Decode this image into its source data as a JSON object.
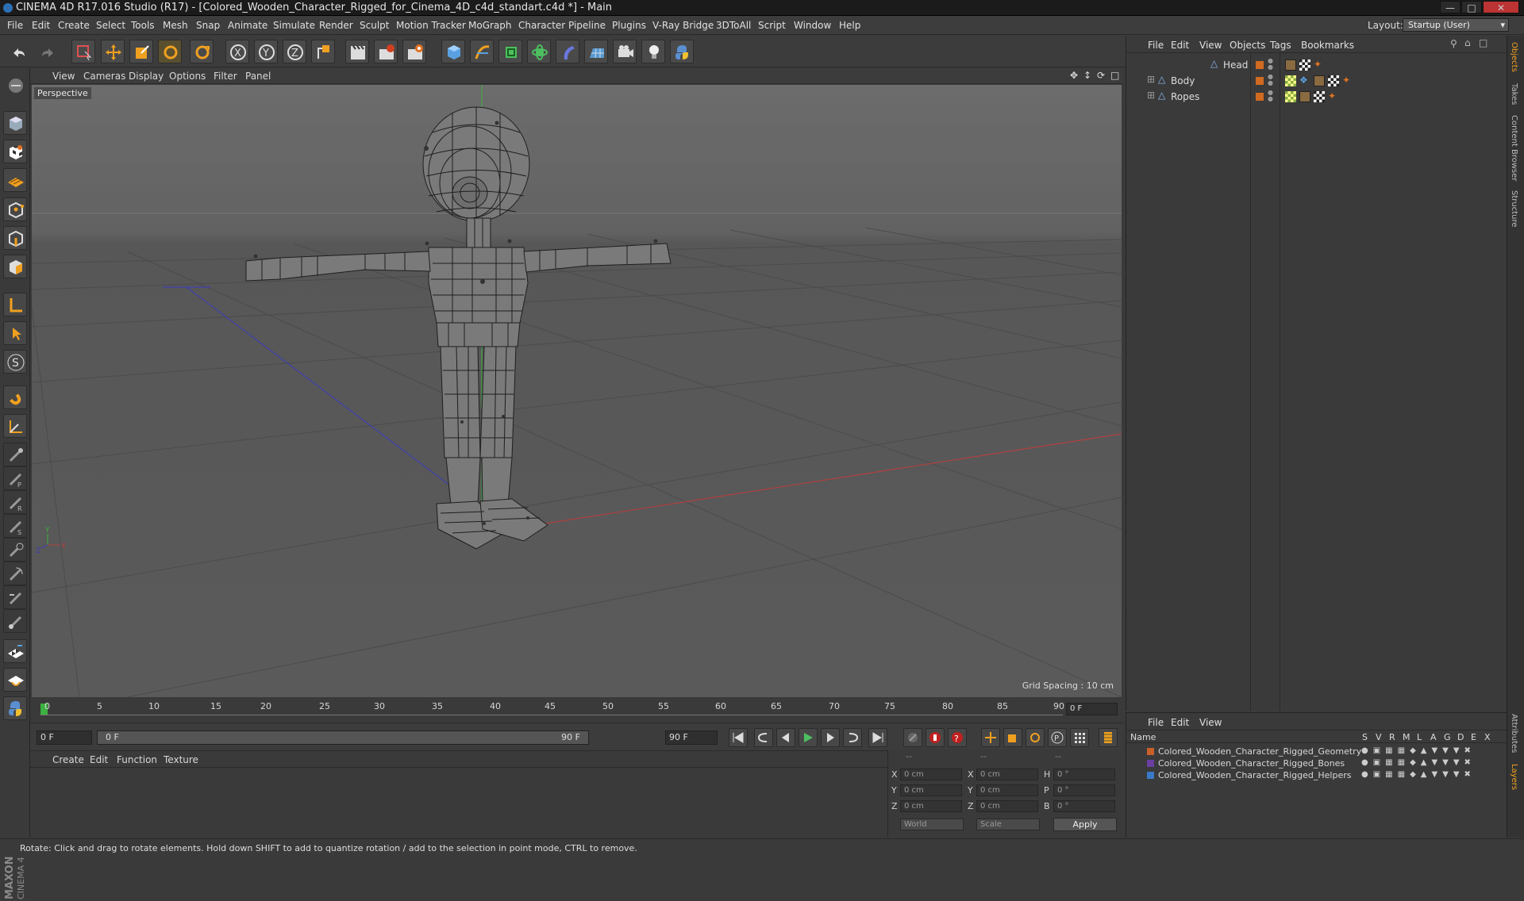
{
  "window": {
    "title": "CINEMA 4D R17.016 Studio (R17) - [Colored_Wooden_Character_Rigged_for_Cinema_4D_c4d_standart.c4d *] - Main"
  },
  "menubar": {
    "items": [
      "File",
      "Edit",
      "Create",
      "Select",
      "Tools",
      "Mesh",
      "Snap",
      "Animate",
      "Simulate",
      "Render",
      "Sculpt",
      "Motion Tracker",
      "MoGraph",
      "Character",
      "Pipeline",
      "Plugins",
      "V-Ray Bridge",
      "3DToAll",
      "Script",
      "Window",
      "Help"
    ],
    "layout_label": "Layout:",
    "layout_value": "Startup (User)"
  },
  "viewport": {
    "menu": [
      "View",
      "Cameras",
      "Display",
      "Options",
      "Filter",
      "Panel"
    ],
    "label": "Perspective",
    "grid_spacing": "Grid Spacing : 10 cm",
    "axis_labels": {
      "y": "Y",
      "x": "X",
      "z": "Z"
    }
  },
  "timeline": {
    "ticks": [
      "0",
      "5",
      "10",
      "15",
      "20",
      "25",
      "30",
      "35",
      "40",
      "45",
      "50",
      "55",
      "60",
      "65",
      "70",
      "75",
      "80",
      "85",
      "90"
    ],
    "frame_right": "0 F",
    "start_field": "0 F",
    "range_start": "0 F",
    "range_end": "90 F",
    "end_field": "90 F"
  },
  "material_panel": {
    "menu": [
      "Create",
      "Edit",
      "Function",
      "Texture"
    ]
  },
  "coordinates": {
    "header": [
      "--",
      "--",
      "--"
    ],
    "rows": [
      {
        "l1": "X",
        "v1": "0 cm",
        "l2": "X",
        "v2": "0 cm",
        "l3": "H",
        "v3": "0 °"
      },
      {
        "l1": "Y",
        "v1": "0 cm",
        "l2": "Y",
        "v2": "0 cm",
        "l3": "P",
        "v3": "0 °"
      },
      {
        "l1": "Z",
        "v1": "0 cm",
        "l2": "Z",
        "v2": "0 cm",
        "l3": "B",
        "v3": "0 °"
      }
    ],
    "mode1": "World",
    "mode2": "Scale",
    "apply": "Apply"
  },
  "objects_panel": {
    "menu": [
      "File",
      "Edit",
      "View",
      "Objects",
      "Tags",
      "Bookmarks"
    ],
    "items": [
      {
        "name": "Head"
      },
      {
        "name": "Body"
      },
      {
        "name": "Ropes"
      }
    ]
  },
  "layers_panel": {
    "menu": [
      "File",
      "Edit",
      "View"
    ],
    "header_name": "Name",
    "flags": [
      "S",
      "V",
      "R",
      "M",
      "L",
      "A",
      "G",
      "D",
      "E",
      "X"
    ],
    "layers": [
      {
        "name": "Colored_Wooden_Character_Rigged_Geometry",
        "color": "#c8602a"
      },
      {
        "name": "Colored_Wooden_Character_Rigged_Bones",
        "color": "#6a3fa0"
      },
      {
        "name": "Colored_Wooden_Character_Rigged_Helpers",
        "color": "#3a78c8"
      }
    ]
  },
  "right_tabs": [
    "Objects",
    "Takes",
    "Content Browser",
    "Structure",
    "Attributes",
    "Layers"
  ],
  "logo": {
    "line1": "MAXON",
    "line2": "CINEMA 4D"
  },
  "status": "Rotate: Click and drag to rotate elements. Hold down SHIFT to add to quantize rotation / add to the selection in point mode, CTRL to remove."
}
